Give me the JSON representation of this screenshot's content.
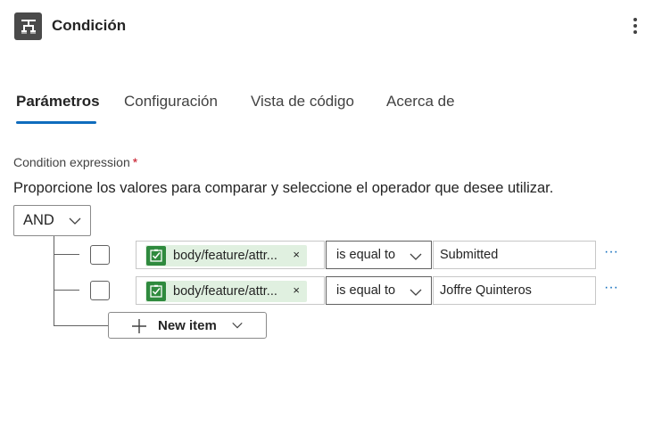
{
  "header": {
    "title": "Condición",
    "icon": "condition-icon",
    "more_icon": "more-vertical-icon"
  },
  "tabs": [
    {
      "label": "Parámetros",
      "active": true
    },
    {
      "label": "Configuración",
      "active": false
    },
    {
      "label": "Vista de código",
      "active": false
    },
    {
      "label": "Acerca de",
      "active": false
    }
  ],
  "condition": {
    "label": "Condition expression",
    "required_mark": "*",
    "description": "Proporcione los valores para comparar y seleccione el operador que desee utilizar.",
    "group_operator": "AND",
    "rows": [
      {
        "token_label": "body/feature/attr...",
        "token_remove": "×",
        "operator": "is equal to",
        "value": "Submitted",
        "more": "···"
      },
      {
        "token_label": "body/feature/attr...",
        "token_remove": "×",
        "operator": "is equal to",
        "value": "Joffre Quinteros",
        "more": "···"
      }
    ],
    "new_item_label": "New item"
  },
  "colors": {
    "accent": "#0f6cbd",
    "token_bg": "#e0f0e0",
    "token_icon": "#2f8a3e",
    "required": "#c50f1f"
  }
}
